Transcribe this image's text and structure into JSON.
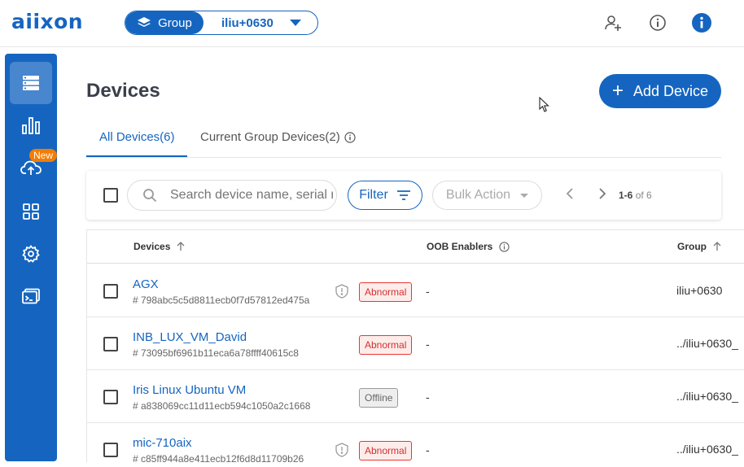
{
  "header": {
    "logo": "aiixon",
    "group_label": "Group",
    "group_value": "iliu+0630",
    "icons": [
      "add-user-icon",
      "info-outline-icon",
      "info-filled-icon"
    ]
  },
  "sidebar": {
    "items": [
      {
        "icon": "devices-icon",
        "active": true
      },
      {
        "icon": "bar-chart-icon"
      },
      {
        "icon": "cloud-upload-icon",
        "badge": "New"
      },
      {
        "icon": "apps-grid-icon"
      },
      {
        "icon": "settings-icon"
      },
      {
        "icon": "terminal-icon"
      }
    ]
  },
  "main": {
    "title": "Devices",
    "add_button": "Add Device",
    "tabs": [
      {
        "label": "All Devices(6)",
        "active": true
      },
      {
        "label": "Current Group Devices(2)"
      }
    ],
    "toolbar": {
      "search_placeholder": "Search device name, serial number",
      "filter_label": "Filter",
      "bulk_label": "Bulk Action",
      "pager_range": "1-6",
      "pager_of": "of 6"
    },
    "table": {
      "columns": [
        "Devices",
        "OOB Enablers",
        "Group"
      ],
      "rows": [
        {
          "name": "AGX",
          "id": "# 798abc5c5d8811ecb0f7d57812ed475a",
          "status": "Abnormal",
          "shield": true,
          "oob": "-",
          "group": "iliu+0630"
        },
        {
          "name": "INB_LUX_VM_David",
          "id": "# 73095bf6961b11eca6a78ffff40615c8",
          "status": "Abnormal",
          "shield": false,
          "oob": "-",
          "group": "../iliu+0630_"
        },
        {
          "name": "Iris Linux Ubuntu VM",
          "id": "# a838069cc11d11ecb594c1050a2c1668",
          "status": "Offline",
          "shield": false,
          "oob": "-",
          "group": "../iliu+0630_"
        },
        {
          "name": "mic-710aix",
          "id": "# c85ff944a8e411ecb12f6d8d11709b26",
          "status": "Abnormal",
          "shield": true,
          "oob": "-",
          "group": "../iliu+0630_"
        }
      ]
    }
  },
  "colors": {
    "brand": "#1565c0",
    "badge": "#f57c00",
    "abnormal": "#d32f2f"
  }
}
